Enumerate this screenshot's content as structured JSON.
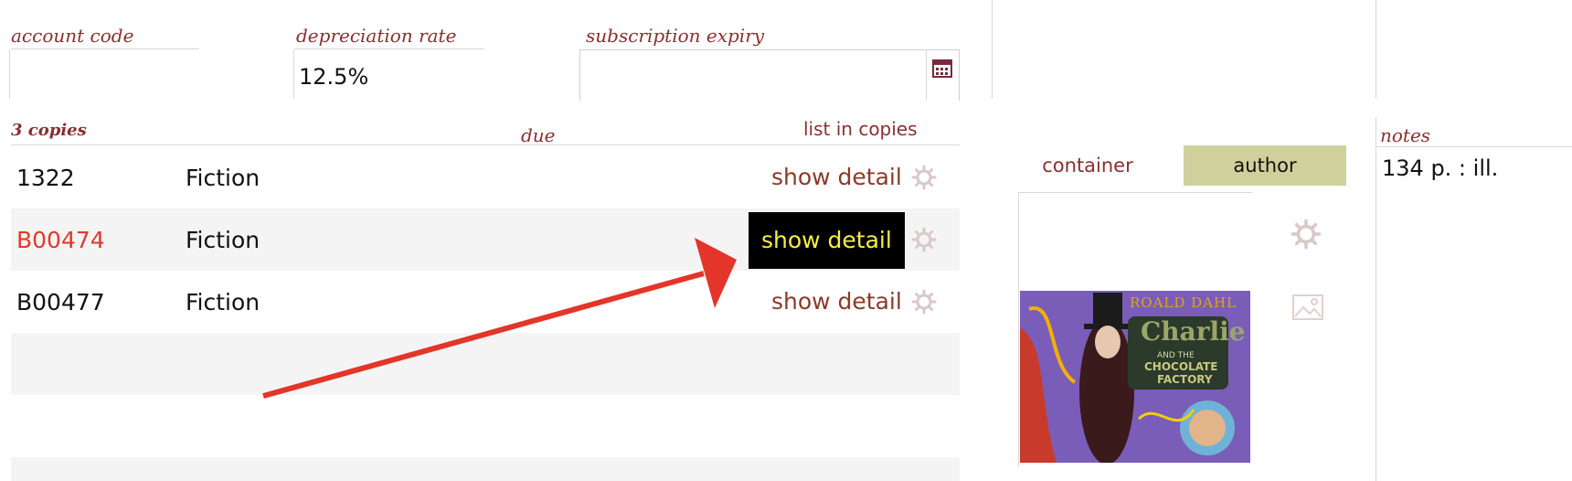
{
  "fields": {
    "account_code": {
      "label": "account code",
      "value": ""
    },
    "depreciation_rate": {
      "label": "depreciation rate",
      "value": "12.5%"
    },
    "subscription_expiry": {
      "label": "subscription expiry",
      "value": ""
    }
  },
  "copies": {
    "count_label": "3 copies",
    "due_label": "due",
    "list_label": "list in copies",
    "rows": [
      {
        "code": "1322",
        "type": "Fiction",
        "detail": "show detail",
        "code_color": "#111111",
        "active": false
      },
      {
        "code": "B00474",
        "type": "Fiction",
        "detail": "show detail",
        "code_color": "#e03a2a",
        "active": true
      },
      {
        "code": "B00477",
        "type": "Fiction",
        "detail": "show detail",
        "code_color": "#111111",
        "active": false
      }
    ]
  },
  "tabs": {
    "container": "container",
    "author": "author",
    "active": "author"
  },
  "notes": {
    "label": "notes",
    "value": "134 p. : ill."
  },
  "cover": {
    "author": "ROALD DAHL",
    "title_line1": "Charlie",
    "title_line2": "AND THE",
    "title_line3": "CHOCOLATE",
    "title_line4": "FACTORY"
  },
  "colors": {
    "label": "#8a2f2f",
    "active_bg": "#000000",
    "active_text": "#f6ee4a",
    "author_tab": "#cfd09c",
    "arrow": "#e3352a"
  }
}
